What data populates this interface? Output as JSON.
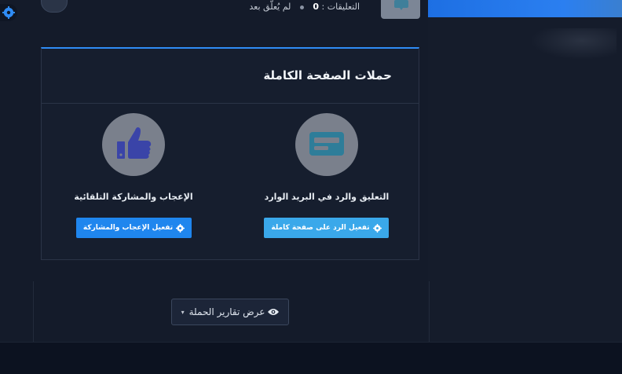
{
  "header": {
    "comments_label": "التعليقات :",
    "comments_count": "0",
    "no_comments_yet": "لم يُعلَّق بعد",
    "thumb_icon": "chat-bubble-icon"
  },
  "card": {
    "title": "حملات الصفحة الكاملة",
    "features": [
      {
        "label": "التعليق والرد في البريد الوارد",
        "icon": "card-icon",
        "button_label": "تفعيل الرد على صفحة كاملة",
        "button_color": "#3aa8ea"
      },
      {
        "label": "الإعجاب والمشاركة التلقائية",
        "icon": "thumbs-up-icon",
        "button_label": "تفعيل الإعجاب والمشاركة",
        "button_color": "#1f86ee"
      }
    ]
  },
  "reports": {
    "button_label": "عرض تقارير الحملة",
    "caret": "▾"
  },
  "colors": {
    "accent": "#2f8cf5",
    "background": "#141b2a"
  }
}
